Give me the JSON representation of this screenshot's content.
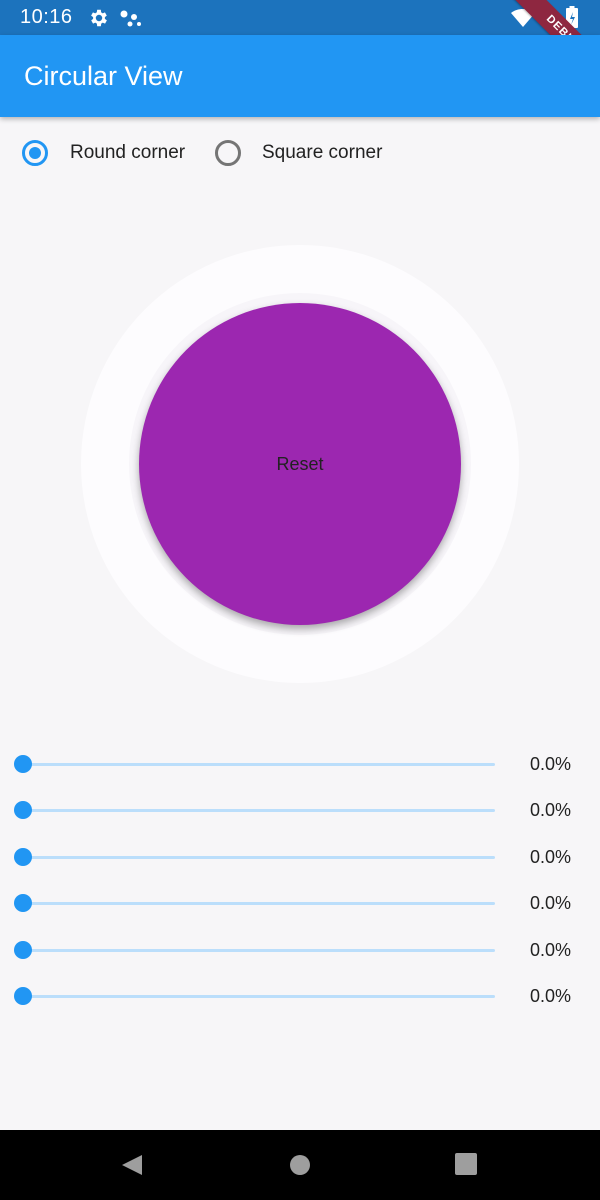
{
  "status_bar": {
    "time": "10:16",
    "icons": [
      "gear-icon",
      "assistant-dots-icon",
      "wifi-icon",
      "battery-icon"
    ],
    "debug_banner": "DEBUG"
  },
  "app_bar": {
    "title": "Circular View",
    "color": "#2196f3"
  },
  "corner_options": {
    "selected": "Round corner",
    "options": [
      {
        "label": "Round corner",
        "selected": true
      },
      {
        "label": "Square corner",
        "selected": false
      }
    ]
  },
  "circle": {
    "color": "#9c27b0",
    "button_label": "Reset"
  },
  "sliders": [
    {
      "value": 0.0,
      "label": "0.0%"
    },
    {
      "value": 0.0,
      "label": "0.0%"
    },
    {
      "value": 0.0,
      "label": "0.0%"
    },
    {
      "value": 0.0,
      "label": "0.0%"
    },
    {
      "value": 0.0,
      "label": "0.0%"
    },
    {
      "value": 0.0,
      "label": "0.0%"
    }
  ],
  "nav_bar": {
    "icons": [
      "back-icon",
      "home-icon",
      "recents-icon"
    ]
  }
}
